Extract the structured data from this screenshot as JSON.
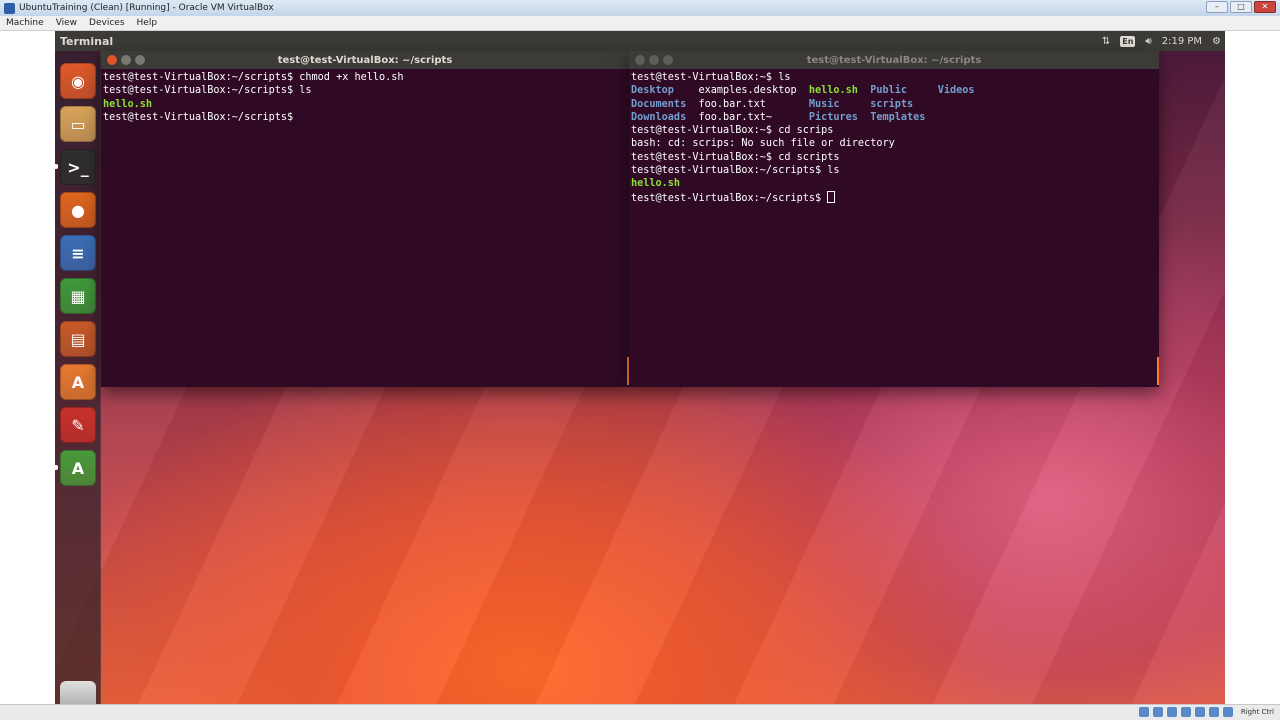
{
  "host_window": {
    "title": "UbuntuTraining (Clean) [Running] - Oracle VM VirtualBox",
    "menu": [
      "Machine",
      "View",
      "Devices",
      "Help"
    ],
    "host_key": "Right Ctrl"
  },
  "top_panel": {
    "app_name": "Terminal",
    "keyboard": "En",
    "time": "2:19 PM"
  },
  "launcher": {
    "items": [
      {
        "name": "dash",
        "color": "#e05a2a"
      },
      {
        "name": "files",
        "color": "#d9a45a"
      },
      {
        "name": "terminal",
        "color": "#2e2e2e"
      },
      {
        "name": "firefox",
        "color": "#e0651e"
      },
      {
        "name": "writer",
        "color": "#3a6fb8"
      },
      {
        "name": "calc",
        "color": "#3f9a3a"
      },
      {
        "name": "impress",
        "color": "#c85a2a"
      },
      {
        "name": "software-center",
        "color": "#e87a30"
      },
      {
        "name": "settings",
        "color": "#c8302a"
      },
      {
        "name": "updater",
        "color": "#4a9a3a"
      }
    ]
  },
  "left_terminal": {
    "title": "test@test-VirtualBox: ~/scripts",
    "lines": [
      [
        {
          "t": "test@test-VirtualBox:~/scripts$ chmod +x hello.sh",
          "c": ""
        }
      ],
      [
        {
          "t": "test@test-VirtualBox:~/scripts$ ls",
          "c": ""
        }
      ],
      [
        {
          "t": "hello.sh",
          "c": "green"
        }
      ],
      [
        {
          "t": "test@test-VirtualBox:~/scripts$ ",
          "c": ""
        }
      ]
    ]
  },
  "right_terminal": {
    "title": "test@test-VirtualBox: ~/scripts",
    "lines": [
      [
        {
          "t": "test@test-VirtualBox:~$ ls",
          "c": ""
        }
      ],
      [
        {
          "t": "Desktop",
          "c": "blue"
        },
        {
          "t": "    examples.desktop  ",
          "c": ""
        },
        {
          "t": "hello.sh",
          "c": "green"
        },
        {
          "t": "  ",
          "c": ""
        },
        {
          "t": "Public",
          "c": "blue"
        },
        {
          "t": "     ",
          "c": ""
        },
        {
          "t": "Videos",
          "c": "blue"
        }
      ],
      [
        {
          "t": "Documents",
          "c": "blue"
        },
        {
          "t": "  foo.bar.txt       ",
          "c": ""
        },
        {
          "t": "Music",
          "c": "blue"
        },
        {
          "t": "     ",
          "c": ""
        },
        {
          "t": "scripts",
          "c": "blue"
        }
      ],
      [
        {
          "t": "Downloads",
          "c": "blue"
        },
        {
          "t": "  foo.bar.txt~      ",
          "c": ""
        },
        {
          "t": "Pictures",
          "c": "blue"
        },
        {
          "t": "  ",
          "c": ""
        },
        {
          "t": "Templates",
          "c": "blue"
        }
      ],
      [
        {
          "t": "test@test-VirtualBox:~$ cd scrips",
          "c": ""
        }
      ],
      [
        {
          "t": "bash: cd: scrips: No such file or directory",
          "c": ""
        }
      ],
      [
        {
          "t": "test@test-VirtualBox:~$ cd scripts",
          "c": ""
        }
      ],
      [
        {
          "t": "test@test-VirtualBox:~/scripts$ ls",
          "c": ""
        }
      ],
      [
        {
          "t": "hello.sh",
          "c": "green"
        }
      ],
      [
        {
          "t": "test@test-VirtualBox:~/scripts$ ",
          "c": ""
        }
      ]
    ]
  }
}
